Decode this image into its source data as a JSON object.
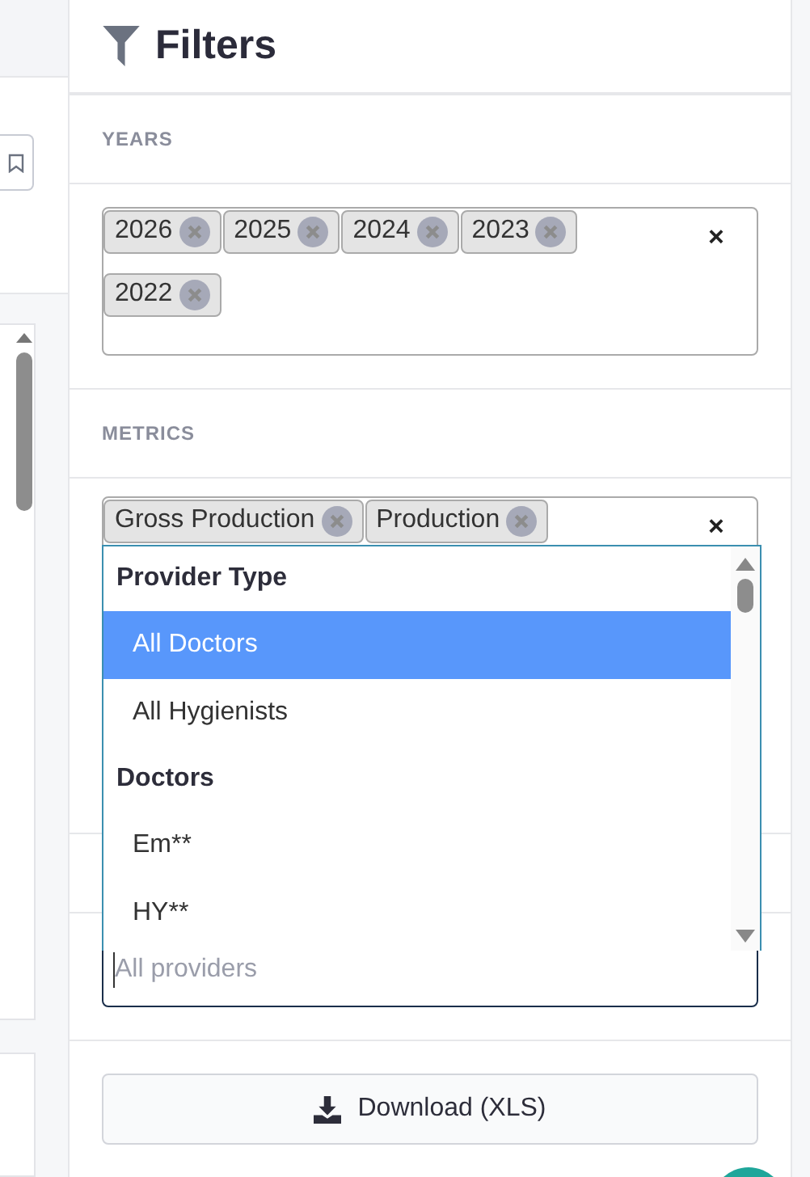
{
  "panel": {
    "title": "Filters"
  },
  "sections": [
    {
      "label": "YEARS",
      "tags": [
        "2026",
        "2025",
        "2024",
        "2023",
        "2022"
      ],
      "clear": "×"
    },
    {
      "label": "METRICS",
      "tags": [
        "Gross Production",
        "Production"
      ],
      "clear": "×"
    }
  ],
  "provider_select": {
    "placeholder": "All providers",
    "groups": [
      {
        "label": "Provider Type",
        "options": [
          {
            "label": "All Doctors",
            "selected": true
          },
          {
            "label": "All Hygienists",
            "selected": false
          }
        ]
      },
      {
        "label": "Doctors",
        "options": [
          {
            "label": "Em**",
            "selected": false
          },
          {
            "label": "HY**",
            "selected": false
          }
        ]
      }
    ]
  },
  "download_button": {
    "label": "Download (XLS)"
  }
}
